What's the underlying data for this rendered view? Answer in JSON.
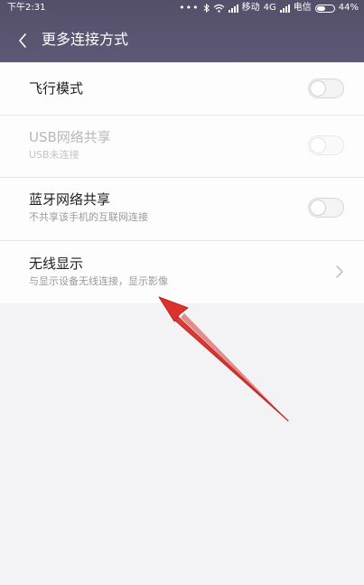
{
  "status_bar": {
    "time": "下午2:31",
    "carrier_1": "移动",
    "network_type": "4G",
    "carrier_2": "电信",
    "battery_percent": "44%"
  },
  "header": {
    "title": "更多连接方式"
  },
  "settings": [
    {
      "title": "飞行模式",
      "subtitle": "",
      "control": "toggle",
      "on": false,
      "enabled": true
    },
    {
      "title": "USB网络共享",
      "subtitle": "USB未连接",
      "control": "toggle",
      "on": false,
      "enabled": false
    },
    {
      "title": "蓝牙网络共享",
      "subtitle": "不共享该手机的互联网连接",
      "control": "toggle",
      "on": false,
      "enabled": true
    },
    {
      "title": "无线显示",
      "subtitle": "与显示设备无线连接，显示影像",
      "control": "chevron",
      "enabled": true
    }
  ],
  "colors": {
    "header_bg": "#5a5671",
    "annotation_arrow": "#d9302c"
  }
}
